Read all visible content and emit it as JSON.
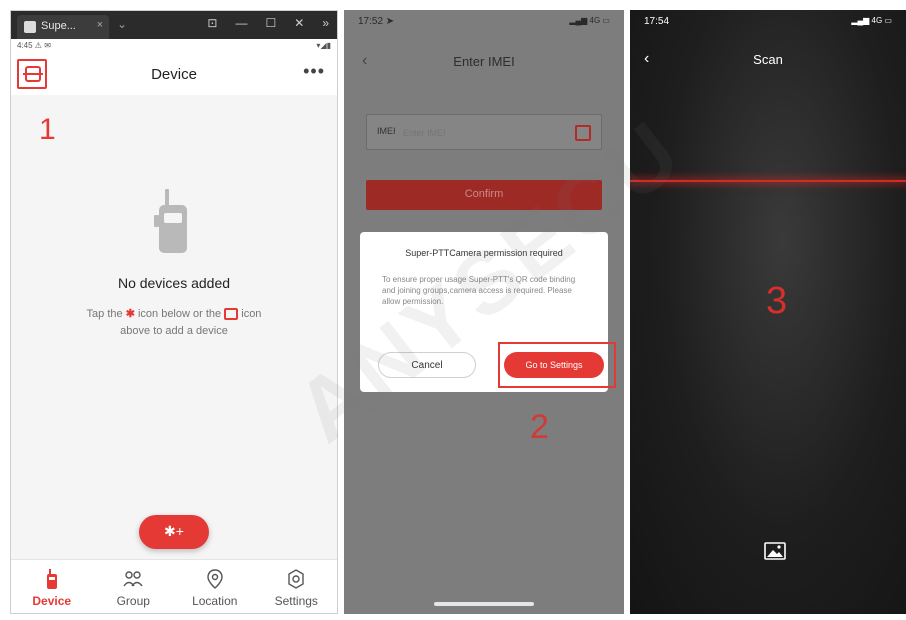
{
  "panel1": {
    "window_tab_title": "Supe...",
    "window_tab_close": "×",
    "window_new_tab": "⌄",
    "window_controls": [
      "⊡",
      "—",
      "☐",
      "✕",
      "»"
    ],
    "status_left": "4:45 ⚠ ✉",
    "status_right": "▾◢▮",
    "header_title": "Device",
    "more_label": "•••",
    "step_label": "1",
    "empty_title": "No devices added",
    "hint_line1_before": "Tap the ",
    "hint_bt_glyph": "✱",
    "hint_line1_middle": " icon below or the ",
    "hint_line1_after": " icon",
    "hint_line2": "above to add a device",
    "fab_glyph": "✱+",
    "nav": [
      {
        "label": "Device",
        "icon": "radio-icon",
        "active": true
      },
      {
        "label": "Group",
        "icon": "group-icon",
        "active": false
      },
      {
        "label": "Location",
        "icon": "location-icon",
        "active": false
      },
      {
        "label": "Settings",
        "icon": "settings-icon",
        "active": false
      }
    ],
    "accent_color": "#e53935"
  },
  "panel2": {
    "status_time": "17:52 ➤",
    "status_signal": "▂▄▆ 4G ▭",
    "back_glyph": "‹",
    "header_title": "Enter IMEI",
    "imei_label": "IMEI",
    "imei_placeholder": "Enter IMEI",
    "confirm_label": "Confirm",
    "dialog_title": "Super-PTTCamera permission required",
    "dialog_body": "To ensure proper usage Super-PTT's QR code binding and joining groups,camera access is required. Please allow permission.",
    "cancel_label": "Cancel",
    "settings_label": "Go to Settings",
    "step_label": "2"
  },
  "panel3": {
    "status_time": "17:54",
    "status_signal": "▂▄▆ 4G ▭",
    "back_glyph": "‹",
    "header_title": "Scan",
    "step_label": "3",
    "scan_line_color": "#d22a25"
  },
  "watermark": "ANYSECU"
}
